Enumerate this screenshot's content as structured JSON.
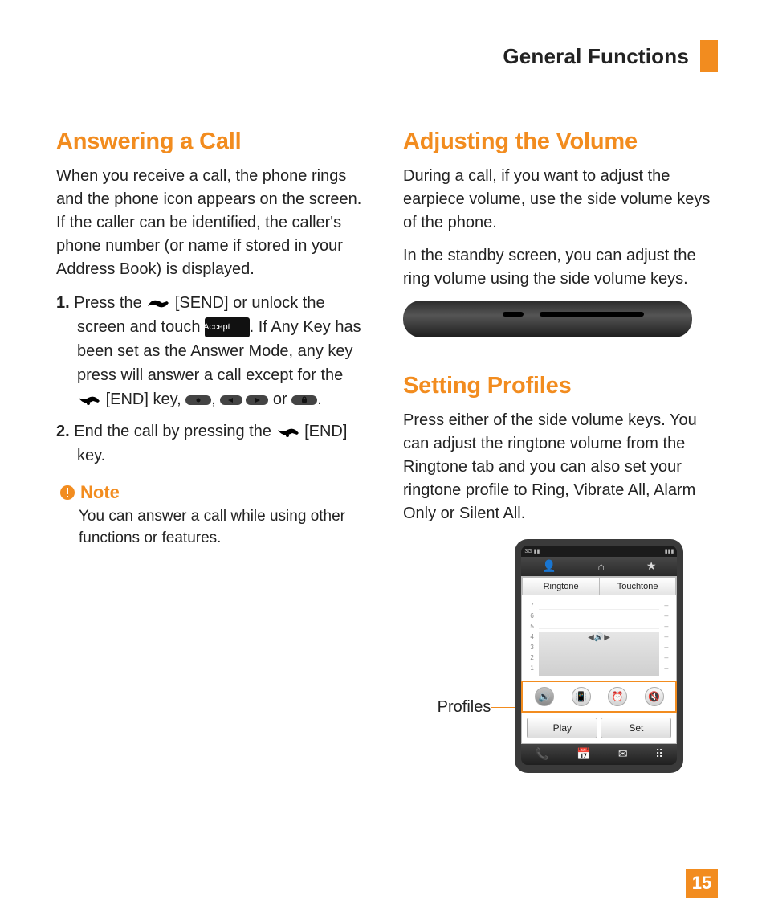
{
  "header": {
    "title": "General Functions"
  },
  "page_number": "15",
  "left": {
    "h1": "Answering a Call",
    "p1": "When you receive a call, the phone rings and the phone icon appears on the screen. If the caller can be identified, the caller's phone number (or name if stored in your Address Book) is displayed.",
    "step1_a": "Press the ",
    "step1_send": "[SEND] or unlock the screen and touch ",
    "accept_btn": "Accept",
    "step1_b": ". If Any Key has been set as the Answer Mode, any key press will answer a call except for the ",
    "step1_end": "[END] key, ",
    "step1_c": ", ",
    "step1_d": " or ",
    "step1_e": ".",
    "step2_a": "End the call by pressing the ",
    "step2_end": "[END] key.",
    "note_label": "Note",
    "note_body": "You can answer a call while using other functions or features."
  },
  "right": {
    "h1": "Adjusting the Volume",
    "p1": "During a call, if you want to adjust the earpiece volume, use the side volume keys of the phone.",
    "p2": "In the standby screen, you can adjust the ring volume using the side volume keys.",
    "h2": "Setting Profiles",
    "p3": "Press either of the side volume keys. You can adjust the ringtone volume from the Ringtone tab and you can also set your ringtone profile to Ring, Vibrate All, Alarm Only or Silent All.",
    "profiles_label": "Profiles"
  },
  "phone_ui": {
    "tabs": [
      "Ringtone",
      "Touchtone"
    ],
    "volume_levels": [
      "7",
      "6",
      "5",
      "4",
      "3",
      "2",
      "1"
    ],
    "volume_current": 4,
    "profile_icons": [
      "speaker",
      "vibrate",
      "alarm",
      "silent"
    ],
    "buttons": [
      "Play",
      "Set"
    ]
  }
}
